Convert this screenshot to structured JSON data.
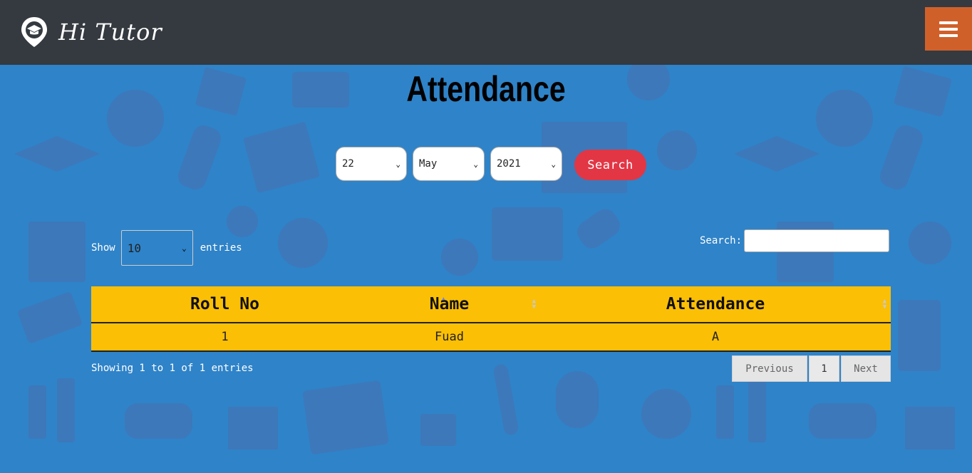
{
  "brand": {
    "name": "Hi Tutor"
  },
  "page": {
    "title": "Attendance"
  },
  "filters": {
    "day": "22",
    "month": "May",
    "year": "2021",
    "search_label": "Search"
  },
  "table_controls": {
    "show_label": "Show",
    "entries_value": "10",
    "entries_label": "entries",
    "search_label": "Search:"
  },
  "table": {
    "headers": [
      "Roll No",
      "Name",
      "Attendance"
    ],
    "rows": [
      {
        "roll_no": "1",
        "name": "Fuad",
        "attendance": "A"
      }
    ]
  },
  "footer": {
    "info": "Showing 1 to 1 of 1 entries",
    "previous": "Previous",
    "page": "1",
    "next": "Next"
  },
  "colors": {
    "navbar": "#343a40",
    "menu_button": "#d0602a",
    "background": "#2f83c8",
    "search_button": "#e23645",
    "table": "#fbbf05"
  },
  "icons": {
    "logo": "map-pin-graduation-cap-icon",
    "menu": "hamburger-icon"
  }
}
